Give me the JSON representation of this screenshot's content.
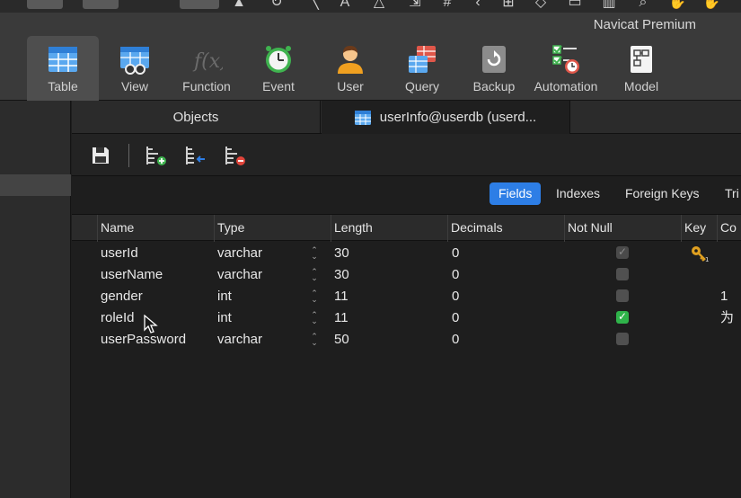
{
  "window": {
    "app_title": "Navicat Premium"
  },
  "toolbar": {
    "items": [
      {
        "label": "Table",
        "icon": "table-icon"
      },
      {
        "label": "View",
        "icon": "view-icon"
      },
      {
        "label": "Function",
        "icon": "function-icon"
      },
      {
        "label": "Event",
        "icon": "event-clock-icon"
      },
      {
        "label": "User",
        "icon": "user-icon"
      },
      {
        "label": "Query",
        "icon": "query-icon"
      },
      {
        "label": "Backup",
        "icon": "backup-icon"
      },
      {
        "label": "Automation",
        "icon": "automation-icon"
      },
      {
        "label": "Model",
        "icon": "model-icon"
      }
    ],
    "active": "Table"
  },
  "tabs": {
    "objects": "Objects",
    "current": "userInfo@userdb (userd..."
  },
  "editor_toolbar": {
    "buttons": [
      "save-icon",
      "add-field-icon",
      "insert-field-icon",
      "delete-field-icon"
    ]
  },
  "subtabs": {
    "items": [
      "Fields",
      "Indexes",
      "Foreign Keys",
      "Tri"
    ],
    "active": "Fields"
  },
  "grid": {
    "columns": [
      "Name",
      "Type",
      "Length",
      "Decimals",
      "Not Null",
      "Key",
      "Co"
    ],
    "rows": [
      {
        "name": "userId",
        "type": "varchar",
        "length": "30",
        "decimals": "0",
        "not_null": true,
        "key": true,
        "comment": ""
      },
      {
        "name": "userName",
        "type": "varchar",
        "length": "30",
        "decimals": "0",
        "not_null": false,
        "key": false,
        "comment": ""
      },
      {
        "name": "gender",
        "type": "int",
        "length": "11",
        "decimals": "0",
        "not_null": false,
        "key": false,
        "comment": "1为"
      },
      {
        "name": "roleId",
        "type": "int",
        "length": "11",
        "decimals": "0",
        "not_null": true,
        "key": false,
        "comment": ""
      },
      {
        "name": "userPassword",
        "type": "varchar",
        "length": "50",
        "decimals": "0",
        "not_null": false,
        "key": false,
        "comment": ""
      }
    ]
  },
  "colors": {
    "accent": "#2d7ee6",
    "checkbox_on": "#2fb34a",
    "key": "#e0a020"
  }
}
